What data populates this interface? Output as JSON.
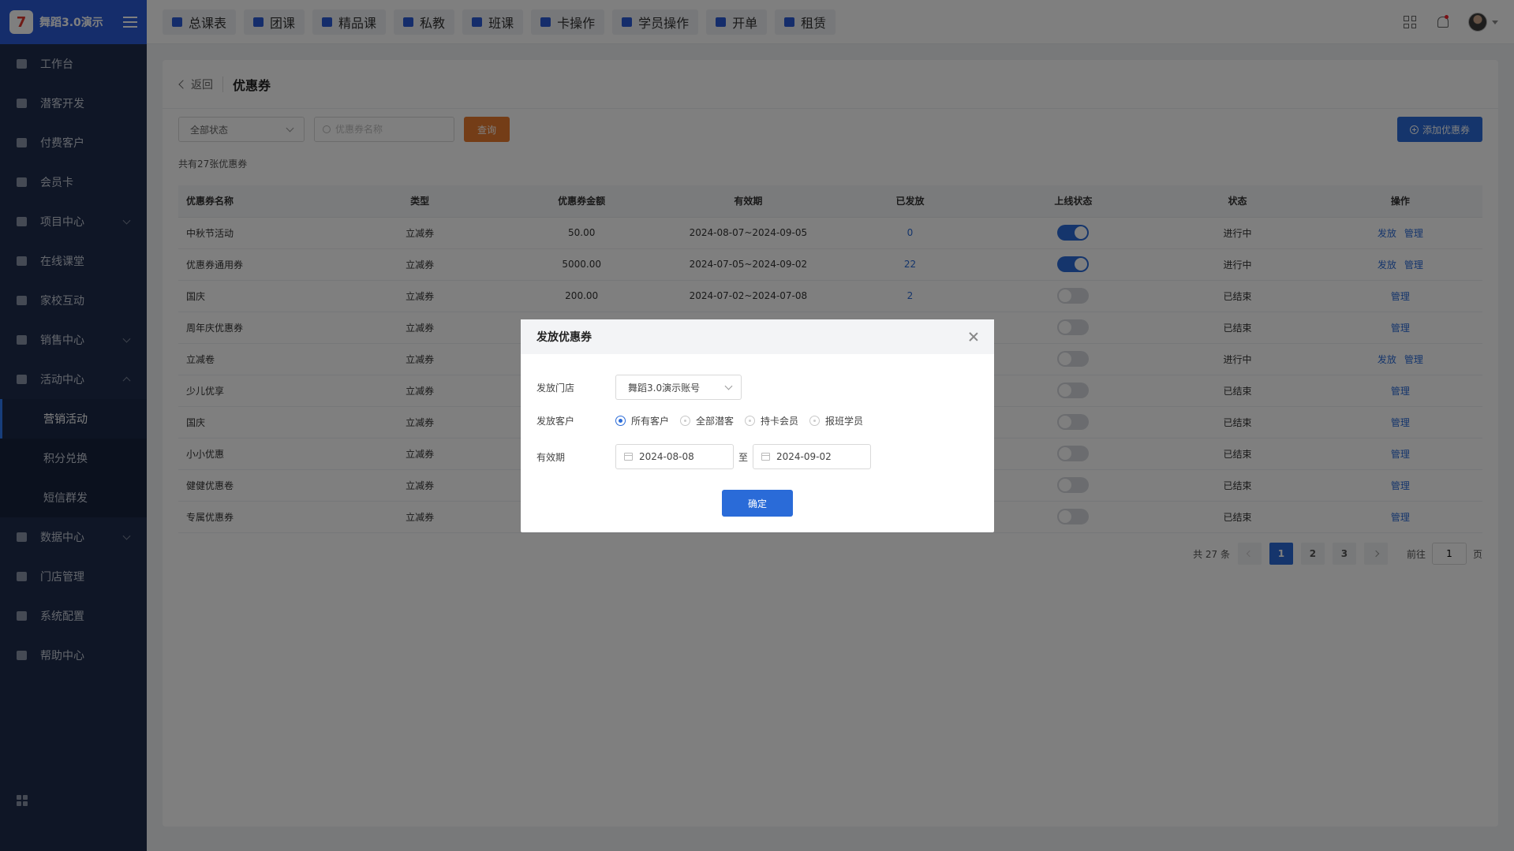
{
  "brand": {
    "name": "舞蹈3.0演示",
    "logo_char": "7"
  },
  "sidebar": {
    "items": [
      {
        "label": "工作台",
        "icon": "desktop-icon"
      },
      {
        "label": "潜客开发",
        "icon": "contact-card-icon"
      },
      {
        "label": "付费客户",
        "icon": "users-icon"
      },
      {
        "label": "会员卡",
        "icon": "card-icon"
      },
      {
        "label": "项目中心",
        "icon": "folder-icon",
        "expandable": true
      },
      {
        "label": "在线课堂",
        "icon": "briefcase-icon"
      },
      {
        "label": "家校互动",
        "icon": "contacts-book-icon"
      },
      {
        "label": "销售中心",
        "icon": "tag-icon",
        "expandable": true
      },
      {
        "label": "活动中心",
        "icon": "calendar-icon",
        "expanded": true
      },
      {
        "label": "数据中心",
        "icon": "pie-chart-icon",
        "expandable": true
      },
      {
        "label": "门店管理",
        "icon": "store-icon"
      },
      {
        "label": "系统配置",
        "icon": "settings-icon"
      },
      {
        "label": "帮助中心",
        "icon": "help-icon"
      }
    ],
    "sub_items": [
      {
        "label": "营销活动",
        "active": true
      },
      {
        "label": "积分兑换"
      },
      {
        "label": "短信群发"
      }
    ]
  },
  "topbar": {
    "tabs": [
      "总课表",
      "团课",
      "精品课",
      "私教",
      "班课",
      "卡操作",
      "学员操作",
      "开单",
      "租赁"
    ]
  },
  "page": {
    "back_label": "返回",
    "title": "优惠券",
    "filter_status": "全部状态",
    "search_placeholder": "优惠券名称",
    "query_label": "查询",
    "add_label": "添加优惠券",
    "count_text": "共有27张优惠券"
  },
  "table": {
    "headers": [
      "优惠券名称",
      "类型",
      "优惠券金额",
      "有效期",
      "已发放",
      "上线状态",
      "状态",
      "操作"
    ],
    "rows": [
      {
        "name": "中秋节活动",
        "type": "立减券",
        "amount": "50.00",
        "period": "2024-08-07~2024-09-05",
        "issued": "0",
        "online": true,
        "status": "进行中",
        "actions": [
          "发放",
          "管理"
        ]
      },
      {
        "name": "优惠券通用券",
        "type": "立减券",
        "amount": "5000.00",
        "period": "2024-07-05~2024-09-02",
        "issued": "22",
        "online": true,
        "status": "进行中",
        "actions": [
          "发放",
          "管理"
        ]
      },
      {
        "name": "国庆",
        "type": "立减券",
        "amount": "200.00",
        "period": "2024-07-02~2024-07-08",
        "issued": "2",
        "online": false,
        "status": "已结束",
        "actions": [
          "管理"
        ]
      },
      {
        "name": "周年庆优惠券",
        "type": "立减券",
        "amount": "",
        "period": "",
        "issued": "",
        "online": false,
        "status": "已结束",
        "actions": [
          "管理"
        ]
      },
      {
        "name": "立减卷",
        "type": "立减券",
        "amount": "",
        "period": "",
        "issued": "",
        "online": false,
        "status": "进行中",
        "actions": [
          "发放",
          "管理"
        ]
      },
      {
        "name": "少儿优享",
        "type": "立减券",
        "amount": "",
        "period": "",
        "issued": "",
        "online": false,
        "status": "已结束",
        "actions": [
          "管理"
        ]
      },
      {
        "name": "国庆",
        "type": "立减券",
        "amount": "",
        "period": "",
        "issued": "",
        "online": false,
        "status": "已结束",
        "actions": [
          "管理"
        ]
      },
      {
        "name": "小小优惠",
        "type": "立减券",
        "amount": "",
        "period": "",
        "issued": "",
        "online": false,
        "status": "已结束",
        "actions": [
          "管理"
        ]
      },
      {
        "name": "健健优惠卷",
        "type": "立减券",
        "amount": "",
        "period": "",
        "issued": "",
        "online": false,
        "status": "已结束",
        "actions": [
          "管理"
        ]
      },
      {
        "name": "专属优惠券",
        "type": "立减券",
        "amount": "",
        "period": "",
        "issued": "",
        "online": false,
        "status": "已结束",
        "actions": [
          "管理"
        ]
      }
    ]
  },
  "pagination": {
    "total_text": "共 27 条",
    "pages": [
      "1",
      "2",
      "3"
    ],
    "current": "1",
    "goto_prefix": "前往",
    "goto_value": "1",
    "goto_suffix": "页"
  },
  "modal": {
    "title": "发放优惠券",
    "store_label": "发放门店",
    "store_value": "舞蹈3.0演示账号",
    "customer_label": "发放客户",
    "customer_options": [
      "所有客户",
      "全部潜客",
      "持卡会员",
      "报班学员"
    ],
    "customer_selected": "所有客户",
    "period_label": "有效期",
    "date_from": "2024-08-08",
    "date_sep": "至",
    "date_to": "2024-09-02",
    "confirm_label": "确定"
  },
  "colors": {
    "primary": "#2a6bd8",
    "query_button": "#e87a2f",
    "sidebar_bg": "#1f2d4d",
    "brand_bg": "#2a5bd7"
  }
}
